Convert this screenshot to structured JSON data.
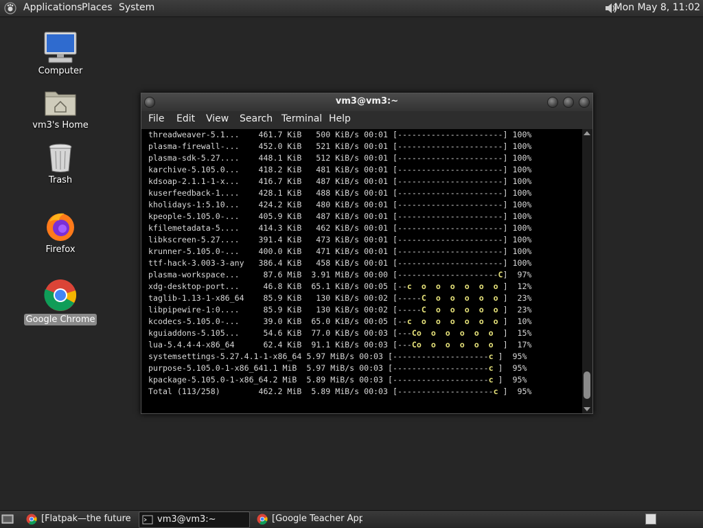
{
  "top_panel": {
    "menus": [
      "Applications",
      "Places",
      "System"
    ],
    "clock": "Mon May  8, 11:02",
    "logo_icon": "gnome-foot-icon",
    "volume_icon": "speaker-icon"
  },
  "desktop_icons": [
    {
      "label": "Computer",
      "icon": "computer-icon"
    },
    {
      "label": "vm3's Home",
      "icon": "home-folder-icon"
    },
    {
      "label": "Trash",
      "icon": "trash-icon"
    },
    {
      "label": "Firefox",
      "icon": "firefox-icon"
    },
    {
      "label": "Google Chrome",
      "icon": "chrome-icon",
      "selected": true
    }
  ],
  "terminal": {
    "title": "vm3@vm3:~",
    "menu": [
      "File",
      "Edit",
      "View",
      "Search",
      "Terminal",
      "Help"
    ],
    "lines": [
      "threadweaver-5.1...    461.7 KiB   500 KiB/s 00:01 [----------------------] 100%",
      "plasma-firewall-...    452.0 KiB   521 KiB/s 00:01 [----------------------] 100%",
      "plasma-sdk-5.27....    448.1 KiB   512 KiB/s 00:01 [----------------------] 100%",
      "karchive-5.105.0...    418.2 KiB   481 KiB/s 00:01 [----------------------] 100%",
      "kdsoap-2.1.1-1-x...    416.7 KiB   487 KiB/s 00:01 [----------------------] 100%",
      "kuserfeedback-1....    428.1 KiB   488 KiB/s 00:01 [----------------------] 100%",
      "kholidays-1:5.10...    424.2 KiB   480 KiB/s 00:01 [----------------------] 100%",
      "kpeople-5.105.0-...    405.9 KiB   487 KiB/s 00:01 [----------------------] 100%",
      "kfilemetadata-5....    414.3 KiB   462 KiB/s 00:01 [----------------------] 100%",
      "libkscreen-5.27....    391.4 KiB   473 KiB/s 00:01 [----------------------] 100%",
      "krunner-5.105.0-...    400.0 KiB   471 KiB/s 00:01 [----------------------] 100%",
      "ttf-hack-3.003-3-any   386.4 KiB   458 KiB/s 00:01 [----------------------] 100%",
      "plasma-workspace...     87.6 MiB  3.91 MiB/s 00:00 [---------------------C]  97%",
      "xdg-desktop-port...     46.8 KiB  65.1 KiB/s 00:05 [--c  o  o  o  o  o  o ]  12%",
      "taglib-1.13-1-x86_64    85.9 KiB   130 KiB/s 00:02 [-----C  o  o  o  o  o ]  23%",
      "libpipewire-1:0....     85.9 KiB   130 KiB/s 00:02 [-----C  o  o  o  o  o ]  23%",
      "kcodecs-5.105.0-...     39.0 KiB  65.0 KiB/s 00:05 [--c  o  o  o  o  o  o ]  10%",
      "kguiaddons-5.105...     54.6 KiB  77.0 KiB/s 00:03 [---Co  o  o  o  o  o  ]  15%",
      "lua-5.4.4-4-x86_64      62.4 KiB  91.1 KiB/s 00:03 [---Co  o  o  o  o  o  ]  17%",
      "systemsettings-5.27.4.1-1-x86_64 5.97 MiB/s 00:03 [--------------------c ]  95%",
      "purpose-5.105.0-1-x86_641.1 MiB  5.97 MiB/s 00:03 [--------------------c ]  95%",
      "kpackage-5.105.0-1-x86_64.2 MiB  5.89 MiB/s 00:03 [--------------------c ]  95%",
      "Total (113/258)        462.2 MiB  5.89 MiB/s 00:03 [--------------------c ]  95%"
    ]
  },
  "taskbar": {
    "show_desktop_icon": "show-desktop-icon",
    "tasks": [
      {
        "label": "[Flatpak—the future ...",
        "icon": "chrome-icon",
        "active": false
      },
      {
        "label": "vm3@vm3:~",
        "icon": "terminal-icon",
        "active": true
      },
      {
        "label": "[Google Teacher App...",
        "icon": "chrome-icon",
        "active": false
      }
    ],
    "workspace_icon": "workspace-switcher-icon"
  }
}
